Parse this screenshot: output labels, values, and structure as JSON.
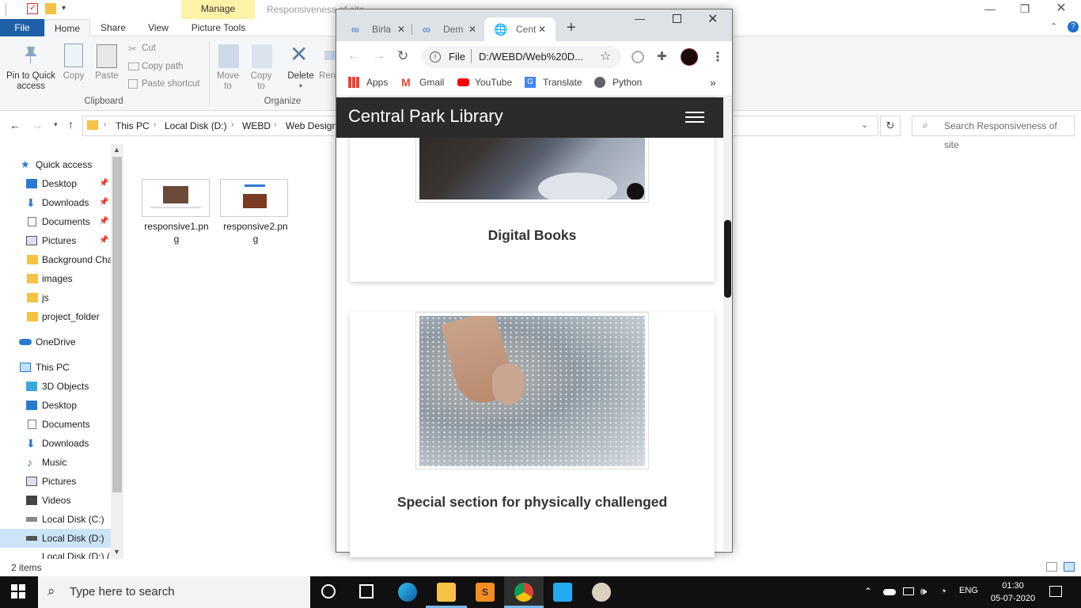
{
  "explorer": {
    "window_title": "Responsiveness of site",
    "contextual_tab": "Manage",
    "tabs": [
      "File",
      "Home",
      "Share",
      "View",
      "Picture Tools"
    ],
    "ribbon": {
      "pin_label": "Pin to Quick access",
      "copy_label": "Copy",
      "paste_label": "Paste",
      "cut_label": "Cut",
      "copy_path_label": "Copy path",
      "paste_shortcut_label": "Paste shortcut",
      "move_to_label": "Move to",
      "copy_to_label": "Copy to",
      "delete_label": "Delete",
      "rename_label": "Rena",
      "group_clipboard": "Clipboard",
      "group_organize": "Organize"
    },
    "address": {
      "crumbs": [
        "This PC",
        "Local Disk (D:)",
        "WEBD",
        "Web Design"
      ],
      "search_placeholder": "Search Responsiveness of site"
    },
    "nav": {
      "quick_access": "Quick access",
      "quick_items": [
        "Desktop",
        "Downloads",
        "Documents",
        "Pictures",
        "Background Cha",
        "images",
        "js",
        "project_folder"
      ],
      "onedrive": "OneDrive",
      "this_pc": "This PC",
      "pc_items": [
        "3D Objects",
        "Desktop",
        "Documents",
        "Downloads",
        "Music",
        "Pictures",
        "Videos",
        "Local Disk (C:)",
        "Local Disk (D:)",
        "Local Disk (D:) (E"
      ]
    },
    "files": [
      {
        "name_line1": "responsive1.pn",
        "name_line2": "g"
      },
      {
        "name_line1": "responsive2.pn",
        "name_line2": "g"
      }
    ],
    "status": "2 items"
  },
  "chrome": {
    "tabs": [
      "Birla",
      "Dem",
      "Cent"
    ],
    "omnibox_scheme": "File",
    "omnibox_url": "D:/WEBD/Web%20D...",
    "bookmarks": [
      "Apps",
      "Gmail",
      "YouTube",
      "Translate",
      "Python"
    ],
    "overflow": "»"
  },
  "site": {
    "brand": "Central Park Library",
    "cards": [
      {
        "title": "Digital Books"
      },
      {
        "title": "Special section for physically challenged"
      }
    ]
  },
  "taskbar": {
    "search_placeholder": "Type here to search",
    "lang": "ENG",
    "time": "01:30",
    "date": "05-07-2020"
  },
  "colors": {
    "file_tab": "#1e5fa8",
    "manage_tab": "#fcf3a7",
    "site_nav": "#2b2b2b",
    "taskbar": "#101010",
    "nav_selected": "#cce4f7"
  }
}
